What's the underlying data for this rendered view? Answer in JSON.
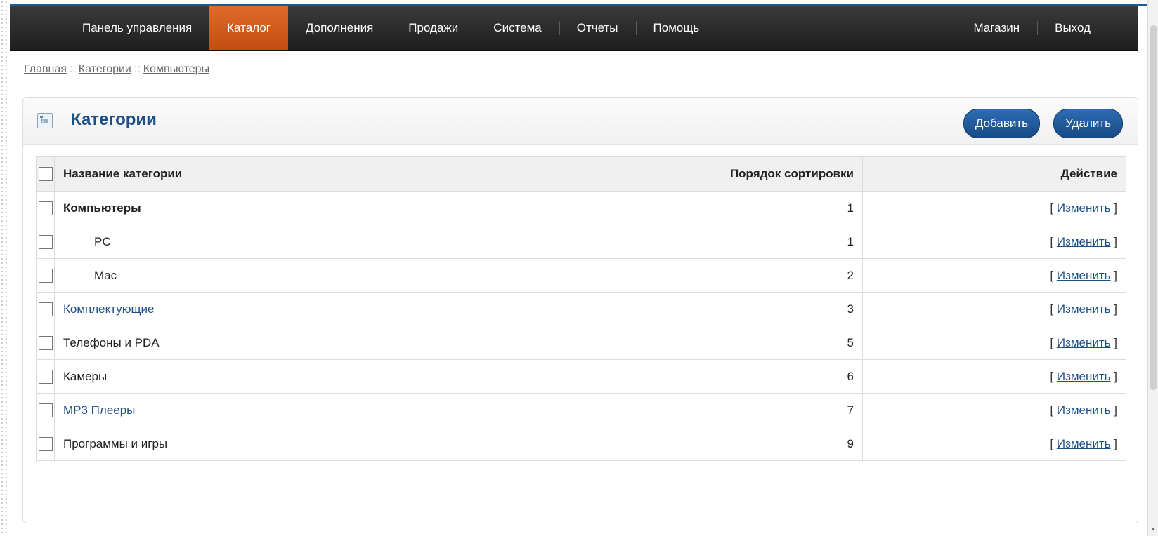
{
  "nav": {
    "left": [
      {
        "label": "Панель управления",
        "active": false
      },
      {
        "label": "Каталог",
        "active": true
      },
      {
        "label": "Дополнения",
        "active": false
      },
      {
        "label": "Продажи",
        "active": false
      },
      {
        "label": "Система",
        "active": false
      },
      {
        "label": "Отчеты",
        "active": false
      },
      {
        "label": "Помощь",
        "active": false
      }
    ],
    "right": [
      {
        "label": "Магазин"
      },
      {
        "label": "Выход"
      }
    ]
  },
  "breadcrumb": {
    "items": [
      "Главная",
      "Категории",
      "Компьютеры"
    ],
    "separator": "::"
  },
  "panel": {
    "title": "Категории",
    "icon": "category-tree-icon",
    "add_label": "Добавить",
    "delete_label": "Удалить"
  },
  "table": {
    "headers": {
      "name": "Название категории",
      "sort": "Порядок сортировки",
      "action": "Действие"
    },
    "action_label": "Изменить",
    "action_open": "[",
    "action_close": "]",
    "rows": [
      {
        "name": "Компьютеры",
        "sort": "1",
        "style": "bold"
      },
      {
        "name": "PC",
        "sort": "1",
        "style": "sub"
      },
      {
        "name": "Mac",
        "sort": "2",
        "style": "sub"
      },
      {
        "name": "Комплектующие",
        "sort": "3",
        "style": "link"
      },
      {
        "name": "Телефоны и PDA",
        "sort": "5",
        "style": "plain"
      },
      {
        "name": "Камеры",
        "sort": "6",
        "style": "plain"
      },
      {
        "name": "MP3 Плееры",
        "sort": "7",
        "style": "link"
      },
      {
        "name": "Программы и игры",
        "sort": "9",
        "style": "plain"
      }
    ]
  },
  "colors": {
    "nav_bg": "#2a2a2a",
    "nav_active": "#d0581a",
    "title": "#1d4f87",
    "button": "#1f5a9c",
    "link": "#1d4f87"
  }
}
